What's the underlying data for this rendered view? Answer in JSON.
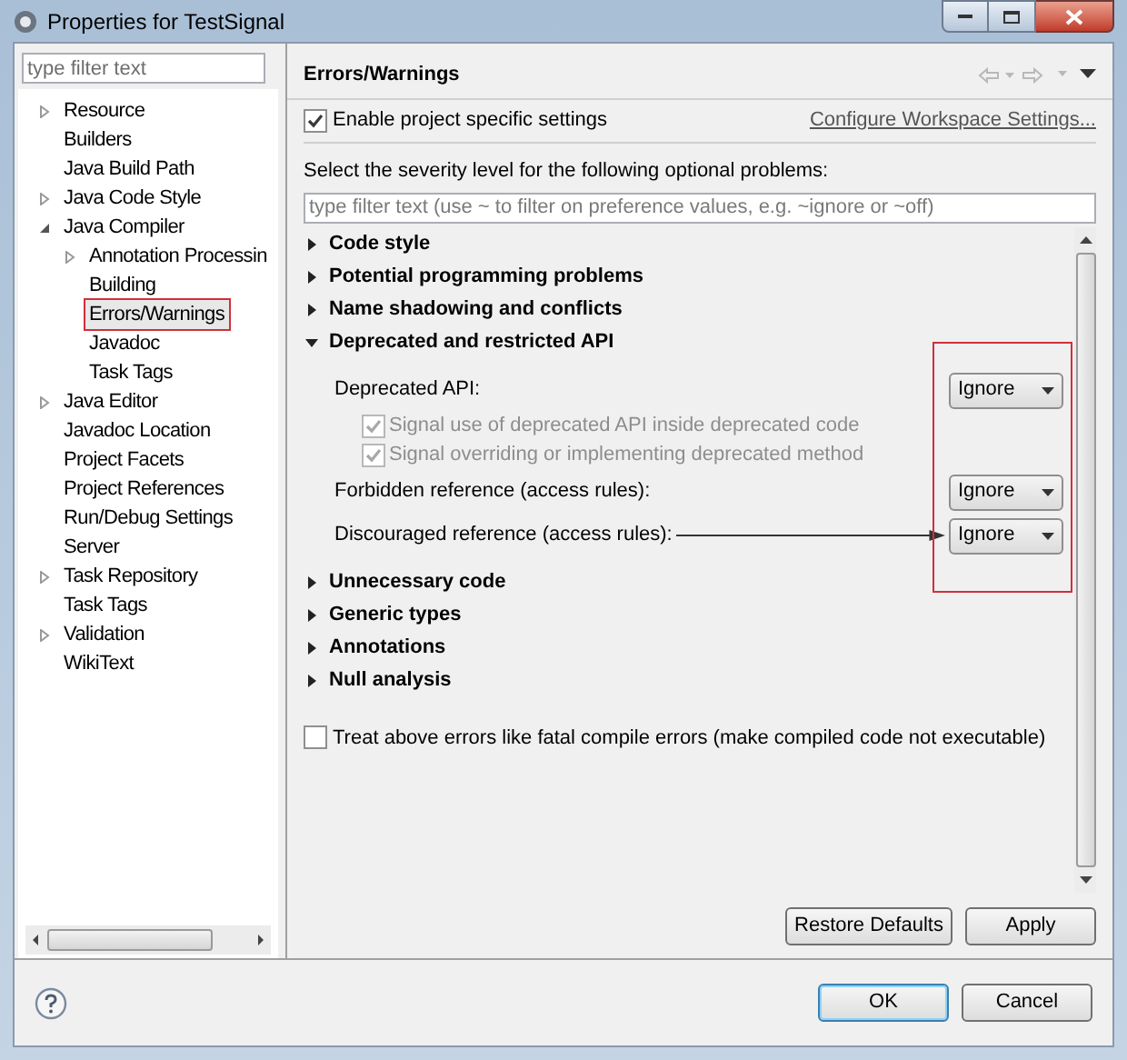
{
  "window": {
    "title": "Properties for TestSignal"
  },
  "sidebar": {
    "filter": {
      "placeholder": "type filter text"
    },
    "tree": [
      {
        "label": "Resource",
        "kind": "folder",
        "expanded": false,
        "selected": false
      },
      {
        "label": "Builders",
        "kind": "leaf",
        "selected": false
      },
      {
        "label": "Java Build Path",
        "kind": "leaf",
        "selected": false
      },
      {
        "label": "Java Code Style",
        "kind": "folder",
        "expanded": false,
        "selected": false
      },
      {
        "label": "Java Compiler",
        "kind": "folder",
        "expanded": true,
        "selected": false,
        "children": [
          {
            "label": "Annotation Processin",
            "kind": "folder",
            "expanded": false,
            "selected": false
          },
          {
            "label": "Building",
            "kind": "leaf",
            "selected": false
          },
          {
            "label": "Errors/Warnings",
            "kind": "leaf",
            "selected": true
          },
          {
            "label": "Javadoc",
            "kind": "leaf",
            "selected": false
          },
          {
            "label": "Task Tags",
            "kind": "leaf",
            "selected": false
          }
        ]
      },
      {
        "label": "Java Editor",
        "kind": "folder",
        "expanded": false,
        "selected": false
      },
      {
        "label": "Javadoc Location",
        "kind": "leaf",
        "selected": false
      },
      {
        "label": "Project Facets",
        "kind": "leaf",
        "selected": false
      },
      {
        "label": "Project References",
        "kind": "leaf",
        "selected": false
      },
      {
        "label": "Run/Debug Settings",
        "kind": "leaf",
        "selected": false
      },
      {
        "label": "Server",
        "kind": "leaf",
        "selected": false
      },
      {
        "label": "Task Repository",
        "kind": "folder",
        "expanded": false,
        "selected": false
      },
      {
        "label": "Task Tags",
        "kind": "leaf",
        "selected": false
      },
      {
        "label": "Validation",
        "kind": "folder",
        "expanded": false,
        "selected": false
      },
      {
        "label": "WikiText",
        "kind": "leaf",
        "selected": false
      }
    ]
  },
  "page": {
    "title": "Errors/Warnings",
    "enable": {
      "label": "Enable project specific settings",
      "checked": true
    },
    "configure_link": "Configure Workspace Settings...",
    "instruction": "Select the severity level for the following optional problems:",
    "filter": {
      "placeholder": "type filter text (use ~ to filter on preference values, e.g. ~ignore or ~off)"
    },
    "sections": [
      {
        "title": "Code style",
        "expanded": false
      },
      {
        "title": "Potential programming problems",
        "expanded": false
      },
      {
        "title": "Name shadowing and conflicts",
        "expanded": false
      },
      {
        "title": "Deprecated and restricted API",
        "expanded": true,
        "highlighted": true,
        "items": [
          {
            "kind": "combo",
            "label": "Deprecated API:",
            "value": "Ignore",
            "arrow": false
          },
          {
            "kind": "checkbox",
            "label": "Signal use of deprecated API inside deprecated code",
            "checked": true,
            "disabled": true
          },
          {
            "kind": "checkbox",
            "label": "Signal overriding or implementing deprecated method",
            "checked": true,
            "disabled": true
          },
          {
            "kind": "combo",
            "label": "Forbidden reference (access rules):",
            "value": "Ignore",
            "arrow": false
          },
          {
            "kind": "combo",
            "label": "Discouraged reference (access rules):",
            "value": "Ignore",
            "arrow": true
          }
        ]
      },
      {
        "title": "Unnecessary code",
        "expanded": false
      },
      {
        "title": "Generic types",
        "expanded": false
      },
      {
        "title": "Annotations",
        "expanded": false
      },
      {
        "title": "Null analysis",
        "expanded": false
      }
    ],
    "fatal": {
      "label": "Treat above errors like fatal compile errors (make compiled code not executable)",
      "checked": false
    },
    "buttons": [
      "Restore Defaults",
      "Apply"
    ]
  },
  "footer": {
    "buttons": [
      {
        "label": "OK",
        "default": true
      },
      {
        "label": "Cancel",
        "default": false
      }
    ]
  }
}
